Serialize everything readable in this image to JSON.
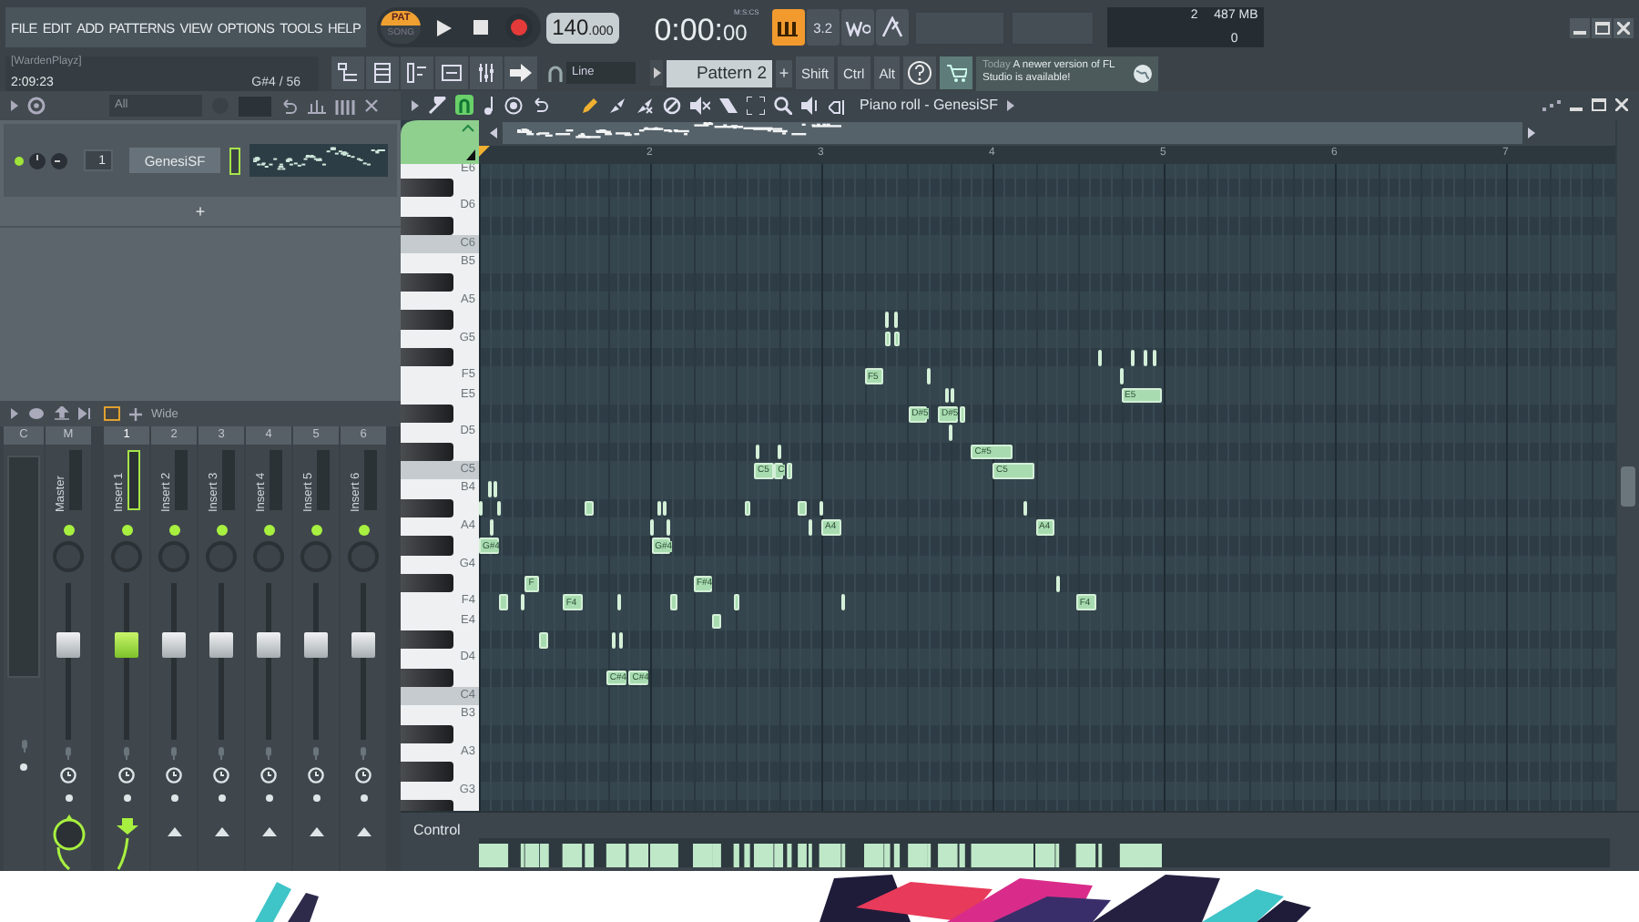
{
  "menu": [
    "FILE",
    "EDIT",
    "ADD",
    "PATTERNS",
    "VIEW",
    "OPTIONS",
    "TOOLS",
    "HELP"
  ],
  "transport": {
    "mode_top": "PAT",
    "mode_bottom": "SONG"
  },
  "tempo": {
    "value": "140",
    "fraction": ".000"
  },
  "time": {
    "main": "0:00:",
    "small": "00",
    "unit": "M:S:CS"
  },
  "toggles": [
    {
      "kind": "loop",
      "on": true
    },
    {
      "kind": "countdown",
      "label": "3.2",
      "on": false
    },
    {
      "kind": "wait",
      "on": false
    },
    {
      "kind": "metronome",
      "on": false
    }
  ],
  "memory": {
    "voices": "2",
    "ram": "487 MB",
    "cpu": "0"
  },
  "hint": {
    "user": "[WardenPlayz]",
    "time": "2:09:23",
    "note": "G#4 / 56"
  },
  "snap": {
    "value": "Line"
  },
  "pattern": {
    "name": "Pattern 2",
    "add": "+"
  },
  "modifiers": [
    "Shift",
    "Ctrl",
    "Alt"
  ],
  "news": {
    "when": "Today",
    "message": "A newer version of FL Studio is available!"
  },
  "channel_rack": {
    "filter": "All",
    "channels": [
      {
        "number": "1",
        "name": "GenesiSF",
        "selected": true
      }
    ],
    "add": "+"
  },
  "mixer": {
    "stereo": "Wide",
    "headers": [
      "C",
      "M",
      "1",
      "2",
      "3",
      "4",
      "5",
      "6"
    ],
    "inserts": [
      {
        "kind": "master",
        "name": "Master",
        "selected": false,
        "level": 0.62
      },
      {
        "kind": "insert",
        "name": "Insert 1",
        "selected": true,
        "level": 0.62
      },
      {
        "kind": "insert",
        "name": "Insert 2",
        "selected": false,
        "level": 0.62
      },
      {
        "kind": "insert",
        "name": "Insert 3",
        "selected": false,
        "level": 0.62
      },
      {
        "kind": "insert",
        "name": "Insert 4",
        "selected": false,
        "level": 0.62
      },
      {
        "kind": "insert",
        "name": "Insert 5",
        "selected": false,
        "level": 0.62
      },
      {
        "kind": "insert",
        "name": "Insert 6",
        "selected": false,
        "level": 0.62
      }
    ]
  },
  "piano_roll": {
    "title": "Piano roll - GenesiSF",
    "bars": [
      "2",
      "3",
      "4",
      "5",
      "6",
      "7"
    ],
    "keys": [
      {
        "kind": "white",
        "label": "E6"
      },
      {
        "kind": "black"
      },
      {
        "kind": "white",
        "label": "D6"
      },
      {
        "kind": "black"
      },
      {
        "kind": "c",
        "label": "C6"
      },
      {
        "kind": "white",
        "label": "B5"
      },
      {
        "kind": "black"
      },
      {
        "kind": "white",
        "label": "A5"
      },
      {
        "kind": "black"
      },
      {
        "kind": "white",
        "label": "G5"
      },
      {
        "kind": "black"
      },
      {
        "kind": "white",
        "label": "F5"
      },
      {
        "kind": "white",
        "label": "E5"
      },
      {
        "kind": "black"
      },
      {
        "kind": "white",
        "label": "D5"
      },
      {
        "kind": "black"
      },
      {
        "kind": "c",
        "label": "C5"
      },
      {
        "kind": "white",
        "label": "B4"
      },
      {
        "kind": "black"
      },
      {
        "kind": "white",
        "label": "A4"
      },
      {
        "kind": "black"
      },
      {
        "kind": "white",
        "label": "G4"
      },
      {
        "kind": "black"
      },
      {
        "kind": "white",
        "label": "F4"
      },
      {
        "kind": "white",
        "label": "E4"
      },
      {
        "kind": "black"
      },
      {
        "kind": "white",
        "label": "D4"
      },
      {
        "kind": "black"
      },
      {
        "kind": "c",
        "label": "C4"
      },
      {
        "kind": "white",
        "label": "B3"
      },
      {
        "kind": "black"
      },
      {
        "kind": "white",
        "label": "A3"
      },
      {
        "kind": "black"
      },
      {
        "kind": "white",
        "label": "G3"
      },
      {
        "kind": "black"
      }
    ],
    "notes": [
      {
        "label": "G#4"
      },
      {
        "label": "F"
      },
      {
        "label": "F4"
      },
      {
        "label": "C#4"
      },
      {
        "label": "C#4"
      },
      {
        "label": "G#4"
      },
      {
        "label": "F#4"
      },
      {
        "label": "C5"
      },
      {
        "label": "C"
      },
      {
        "label": "A4"
      },
      {
        "label": "F5"
      },
      {
        "label": "D#5"
      },
      {
        "label": "D#5"
      },
      {
        "label": "C#5"
      },
      {
        "label": "C5"
      },
      {
        "label": "A4"
      },
      {
        "label": "F4"
      },
      {
        "label": "E5"
      }
    ],
    "control": "Control"
  }
}
